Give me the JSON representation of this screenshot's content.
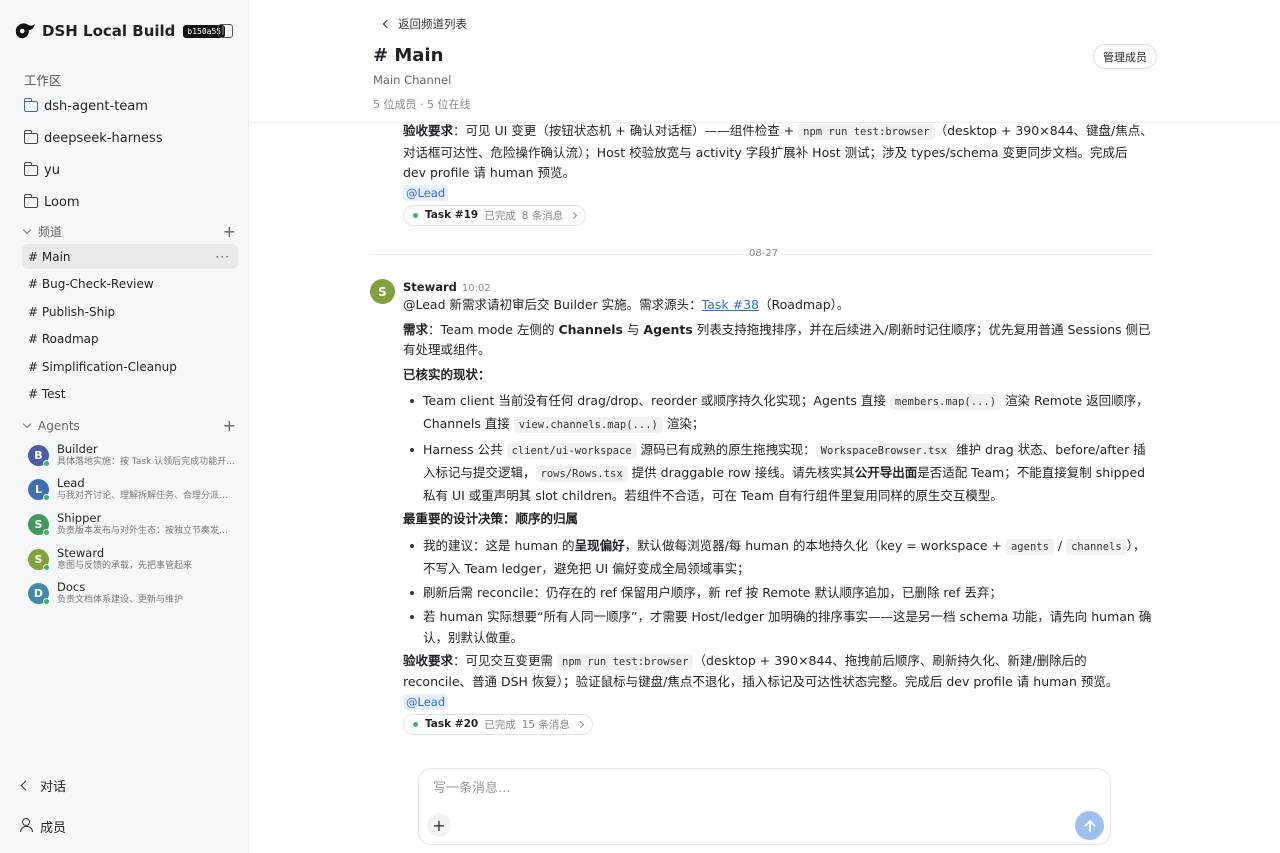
{
  "app": {
    "title": "DSH Local Build",
    "build": "b150a55"
  },
  "sidebar": {
    "workspace_label": "工作区",
    "workspaces": [
      "dsh-agent-team",
      "deepseek-harness",
      "yu",
      "Loom"
    ],
    "channels_label": "频道",
    "channels": [
      "# Main",
      "# Bug-Check-Review",
      "# Publish-Ship",
      "# Roadmap",
      "# Simplification-Cleanup",
      "# Test"
    ],
    "active_channel_more": "···",
    "agents_label": "Agents",
    "agents": [
      {
        "initial": "B",
        "name": "Builder",
        "desc": "具体落地实施：按 Task 认领后完成功能开...",
        "color": "#4a5ca8"
      },
      {
        "initial": "L",
        "name": "Lead",
        "desc": "与我对齐讨论、理解拆解任务、合理分派编...",
        "color": "#3f6fb5"
      },
      {
        "initial": "S",
        "name": "Shipper",
        "desc": "负责版本发布与对外生态：按独立节奏发布...",
        "color": "#3f9a5e"
      },
      {
        "initial": "S",
        "name": "Steward",
        "desc": "意图与反馈的承载，先把事管起来",
        "color": "#7fa23c"
      },
      {
        "initial": "D",
        "name": "Docs",
        "desc": "负责文档体系建设、更新与维护",
        "color": "#3f8aa8"
      }
    ],
    "footer": {
      "chat": "对话",
      "members": "成员"
    }
  },
  "header": {
    "back": "返回频道列表",
    "title": "# Main",
    "subtitle": "Main Channel",
    "stats": "5 位成员 · 5 位在线",
    "manage": "管理成员"
  },
  "feed": {
    "prev_msg": {
      "accept_label": "验收要求",
      "accept_1": "：可见 UI 变更（按钮状态机 + 确认对话框）——组件检查 + ",
      "accept_code": "npm run test:browser",
      "accept_2": "（desktop + 390×844、键盘/焦点、对话框可达性、危险操作确认流）；Host 校验放宽与 activity 字段扩展补 Host 测试；涉及 types/schema 变更同步文档。完成后 dev profile 请 human 预览。",
      "mention": "@Lead",
      "task": {
        "name": "Task #19",
        "state": "已完成",
        "count": "8 条消息"
      }
    },
    "date": "08-27",
    "msg": {
      "initial": "S",
      "author": "Steward",
      "time": "10:02",
      "intro_1": "@Lead 新需求请初审后交 Builder 实施。需求源头：",
      "intro_link": "Task #38",
      "intro_2": "（Roadmap）。",
      "req_label": "需求",
      "req_1": "：Team mode 左侧的 ",
      "req_b1": "Channels",
      "req_2": " 与 ",
      "req_b2": "Agents",
      "req_3": " 列表支持拖拽排序，并在后续进入/刷新时记住顺序；优先复用普通 Sessions 侧已有处理或组件。",
      "facts_label": "已核实的现状",
      "colon": "：",
      "f1_1": "Team client 当前没有任何 drag/drop、reorder 或顺序持久化实现；Agents 直接 ",
      "f1_c1": "members.map(...)",
      "f1_2": " 渲染 Remote 返回顺序，Channels 直接 ",
      "f1_c2": "view.channels.map(...)",
      "f1_3": " 渲染；",
      "f2_1": "Harness 公共 ",
      "f2_c1": "client/ui-workspace",
      "f2_2": " 源码已有成熟的原生拖拽实现：",
      "f2_c2": "WorkspaceBrowser.tsx",
      "f2_3": " 维护 drag 状态、before/after 插入标记与提交逻辑，",
      "f2_c3": "rows/Rows.tsx",
      "f2_4": " 提供 draggable row 接线。请先核实其",
      "f2_b": "公开导出面",
      "f2_5": "是否适配 Team；不能直接复制 shipped 私有 UI 或重声明其 slot children。若组件不合适，可在 Team 自有行组件里复用同样的原生交互模型。",
      "decision_label": "最重要的设计决策：顺序的归属",
      "d1_1": "我的建议：这是 human 的",
      "d1_b": "呈现偏好",
      "d1_2": "，默认做每浏览器/每 human 的本地持久化（key = workspace + ",
      "d1_c1": "agents",
      "d1_3": " / ",
      "d1_c2": "channels",
      "d1_4": "），不写入 Team ledger，避免把 UI 偏好变成全局领域事实；",
      "d2": "刷新后需 reconcile：仍存在的 ref 保留用户顺序，新 ref 按 Remote 默认顺序追加，已删除 ref 丢弃；",
      "d3": "若 human 实际想要“所有人同一顺序”，才需要 Host/ledger 加明确的排序事实——这是另一档 schema 功能，请先向 human 确认，别默认做重。",
      "accept_label": "验收要求",
      "a_1": "：可见交互变更需 ",
      "a_c": "npm run test:browser",
      "a_2": "（desktop + 390×844、拖拽前后顺序、刷新持久化、新建/删除后的 reconcile、普通 DSH 恢复）；验证鼠标与键盘/焦点不退化，插入标记及可达性状态完整。完成后 dev profile 请 human 预览。",
      "mention": "@Lead",
      "task": {
        "name": "Task #20",
        "state": "已完成",
        "count": "15 条消息"
      }
    }
  },
  "composer": {
    "placeholder": "写一条消息..."
  }
}
